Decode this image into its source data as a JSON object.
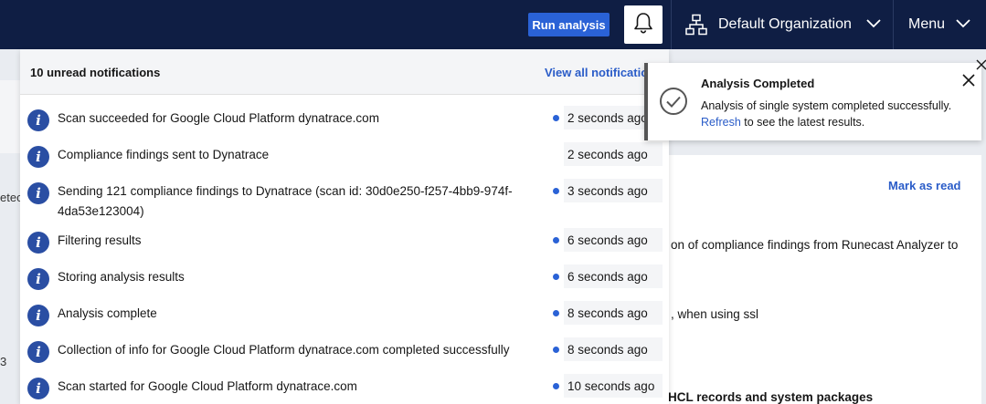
{
  "header": {
    "run_button": "Run analysis",
    "organization": "Default Organization",
    "menu": "Menu"
  },
  "notifications": {
    "title": "10 unread notifications",
    "view_all": "View all notifications",
    "items": [
      {
        "message": "Scan succeeded for Google Cloud Platform dynatrace.com",
        "time": "2 seconds ago",
        "unread": true
      },
      {
        "message": "Compliance findings sent to Dynatrace",
        "time": "2 seconds ago",
        "unread": false
      },
      {
        "message": "Sending 121 compliance findings to Dynatrace (scan id: 30d0e250-f257-4bb9-974f-4da53e123004)",
        "time": "3 seconds ago",
        "unread": true
      },
      {
        "message": "Filtering results",
        "time": "6 seconds ago",
        "unread": true
      },
      {
        "message": "Storing analysis results",
        "time": "6 seconds ago",
        "unread": true
      },
      {
        "message": "Analysis complete",
        "time": "8 seconds ago",
        "unread": true
      },
      {
        "message": "Collection of info for Google Cloud Platform dynatrace.com completed successfully",
        "time": "8 seconds ago",
        "unread": true
      },
      {
        "message": "Scan started for Google Cloud Platform dynatrace.com",
        "time": "10 seconds ago",
        "unread": true
      }
    ]
  },
  "toast": {
    "title": "Analysis Completed",
    "body_line1": "Analysis of single system completed successfully.",
    "link": "Refresh",
    "body_line2_rest": " to see the latest results."
  },
  "background": {
    "mark_as_read": "Mark as read",
    "line1": "on of compliance findings from Runecast Analyzer to",
    "line2": ", when using ssl",
    "line3": "HCL records and system packages",
    "left_fragment1": "etec",
    "left_fragment2": "3"
  },
  "colors": {
    "header_bg": "#0f1e44",
    "accent": "#2a62d6",
    "link": "#2a5cc8",
    "info_icon": "#2a4ea3"
  }
}
